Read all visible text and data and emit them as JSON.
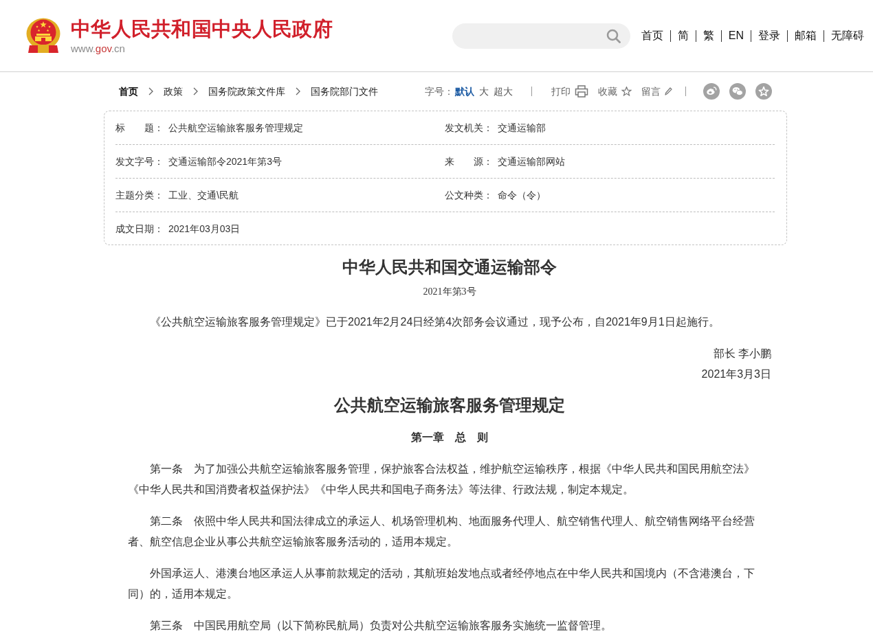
{
  "header": {
    "site_title": "中华人民共和国中央人民政府",
    "site_url": {
      "prefix": "www.",
      "domain": "gov",
      "suffix": ".cn"
    },
    "nav": [
      "首页",
      "简",
      "繁",
      "EN",
      "登录",
      "邮箱",
      "无障碍"
    ]
  },
  "breadcrumb": [
    {
      "label": "首页",
      "kind": "home"
    },
    {
      "label": "政策",
      "kind": "link"
    },
    {
      "label": "国务院政策文件库",
      "kind": "link"
    },
    {
      "label": "国务院部门文件",
      "kind": "link"
    }
  ],
  "toolbar": {
    "font_size_label": "字号：",
    "font_sizes": [
      {
        "label": "默认",
        "selected": true
      },
      {
        "label": "大",
        "selected": false
      },
      {
        "label": "超大",
        "selected": false
      }
    ],
    "actions": [
      {
        "label": "打印",
        "kind": "print"
      },
      {
        "label": "收藏",
        "kind": "favorite"
      },
      {
        "label": "留言",
        "kind": "comment"
      }
    ]
  },
  "info_table": {
    "rows": [
      {
        "cells": [
          {
            "label": "标　　题：",
            "value": "公共航空运输旅客服务管理规定"
          },
          {
            "label": "发文机关：",
            "value": "交通运输部"
          }
        ]
      },
      {
        "cells": [
          {
            "label": "发文字号：",
            "value": "交通运输部令2021年第3号"
          },
          {
            "label": "来　　源：",
            "value": "交通运输部网站"
          }
        ]
      },
      {
        "cells": [
          {
            "label": "主题分类：",
            "value": "工业、交通\\民航"
          },
          {
            "label": "公文种类：",
            "value": "命令（令）"
          }
        ]
      },
      {
        "cells": [
          {
            "label": "成文日期：",
            "value": "2021年03月03日"
          }
        ]
      }
    ]
  },
  "document": {
    "title": "中华人民共和国交通运输部令",
    "number": "2021年第3号",
    "preamble": "《公共航空运输旅客服务管理规定》已于2021年2月24日经第4次部务会议通过，现予公布，自2021年9月1日起施行。",
    "signature": [
      "部长 李小鹏",
      "2021年3月3日"
    ],
    "regulation_title": "公共航空运输旅客服务管理规定",
    "chapter": "第一章　总　则",
    "articles": [
      "第一条　为了加强公共航空运输旅客服务管理，保护旅客合法权益，维护航空运输秩序，根据《中华人民共和国民用航空法》《中华人民共和国消费者权益保护法》《中华人民共和国电子商务法》等法律、行政法规，制定本规定。",
      "第二条　依照中华人民共和国法律成立的承运人、机场管理机构、地面服务代理人、航空销售代理人、航空销售网络平台经营者、航空信息企业从事公共航空运输旅客服务活动的，适用本规定。",
      "外国承运人、港澳台地区承运人从事前款规定的活动，其航班始发地点或者经停地点在中华人民共和国境内（不含港澳台，下同）的，适用本规定。",
      "第三条　中国民用航空局（以下简称民航局）负责对公共航空运输旅客服务实施统一监督管理。"
    ]
  }
}
